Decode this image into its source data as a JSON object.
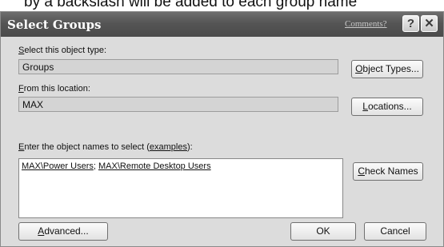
{
  "caption": "by a backslash will be added to each group name",
  "window": {
    "title": "Select Groups",
    "comments_link": "Comments?",
    "help_glyph": "?",
    "close_glyph": "✕"
  },
  "object_type": {
    "label_accel": "S",
    "label_rest": "elect this object type:",
    "value": "Groups",
    "button_accel": "O",
    "button_rest": "bject Types..."
  },
  "location": {
    "label_accel": "F",
    "label_rest": "rom this location:",
    "value": "MAX",
    "button_accel": "L",
    "button_rest": "ocations..."
  },
  "names": {
    "label_accel": "E",
    "label_rest": "nter the object names to select (",
    "examples_link": "examples",
    "label_end": "):",
    "entry1": "MAX\\Power Users",
    "separator": "; ",
    "entry2": "MAX\\Remote Desktop Users",
    "check_accel": "C",
    "check_rest": "heck Names"
  },
  "footer": {
    "advanced_accel": "A",
    "advanced_rest": "dvanced...",
    "ok_label": "OK",
    "cancel_label": "Cancel"
  }
}
